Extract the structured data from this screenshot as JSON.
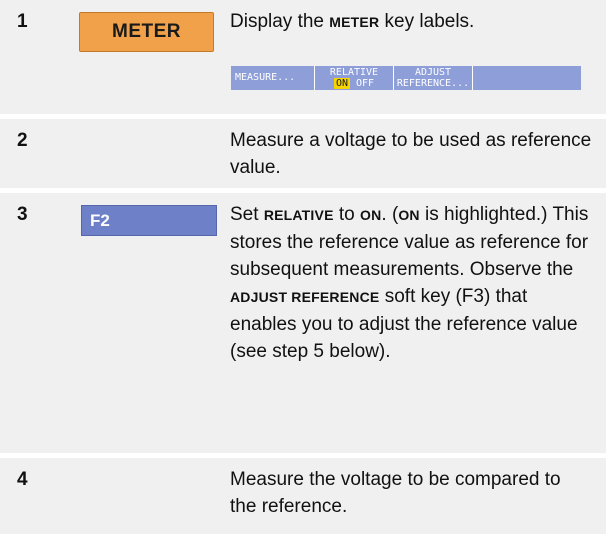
{
  "colors": {
    "row_background": "#f0f0f0",
    "meter_key": "#f0a14a",
    "function_key": "#6d80c8",
    "softkey_bar": "#8d9ed9",
    "highlight": "#f5d400"
  },
  "steps": [
    {
      "number": "1",
      "key": {
        "label": "METER",
        "icon": "meter-key",
        "color": "#f0a14a"
      },
      "description": {
        "before": "Display the ",
        "keyword": "METER",
        "after": " key labels."
      },
      "softkeys": {
        "key1": "MEASURE...",
        "key2_top": "RELATIVE",
        "key2_on": "ON",
        "key2_off": "OFF",
        "key3_top": "ADJUST",
        "key3_bottom": "REFERENCE..."
      }
    },
    {
      "number": "2",
      "description": {
        "text": "Measure a voltage to be used as reference value."
      }
    },
    {
      "number": "3",
      "key": {
        "label": "F2",
        "icon": "function-key-f2",
        "color": "#6d80c8"
      },
      "description": {
        "p1": "Set ",
        "k1": "RELATIVE",
        "p2": " to ",
        "k2": "ON",
        "p3": ". (",
        "k3": "ON",
        "p4": " is highlighted.) This stores the reference value as reference for subsequent measurements. Observe the ",
        "k4": "ADJUST REFERENCE",
        "p5": " soft key (F3) that enables you to adjust the reference value (see step 5 below)."
      }
    },
    {
      "number": "4",
      "description": {
        "text": "Measure the voltage to be compared to the reference."
      }
    }
  ]
}
